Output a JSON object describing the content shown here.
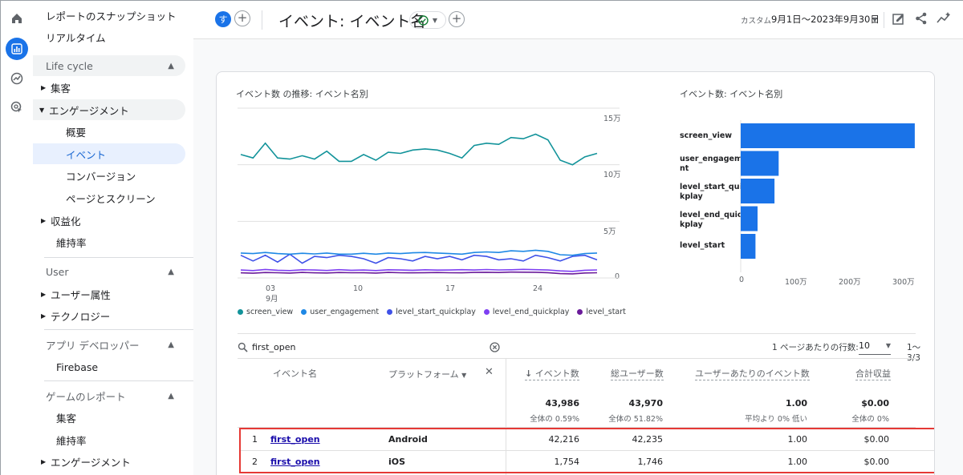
{
  "sidebar": {
    "items": [
      {
        "label": "レポートのスナップショット"
      },
      {
        "label": "リアルタイム"
      }
    ],
    "lifecycle": {
      "header": "Life cycle",
      "acquisition": "集客",
      "engagement": "エンゲージメント",
      "overview": "概要",
      "events": "イベント",
      "conversions": "コンバージョン",
      "pages": "ページとスクリーン",
      "monetization": "収益化",
      "retention": "維持率"
    },
    "user": {
      "header": "User",
      "attributes": "ユーザー属性",
      "technology": "テクノロジー"
    },
    "dev": {
      "header": "アプリ デベロッパー",
      "firebase": "Firebase"
    },
    "games": {
      "header": "ゲームのレポート",
      "acquisition": "集客",
      "retention": "維持率",
      "engagement": "エンゲージメント"
    }
  },
  "header": {
    "avatar_letter": "す",
    "title": "イベント: イベント名",
    "date_prefix": "カスタム",
    "date_range": "9月1日～2023年9月30日"
  },
  "line_chart": {
    "title": "イベント数 の推移: イベント名別",
    "y_ticks": [
      "15万",
      "10万",
      "5万",
      "0"
    ],
    "x_ticks": [
      "03",
      "10",
      "17",
      "24"
    ],
    "x_month": "9月",
    "legend": [
      {
        "name": "screen_view",
        "color": "#12939a"
      },
      {
        "name": "user_engagement",
        "color": "#1e88e5"
      },
      {
        "name": "level_start_quickplay",
        "color": "#3f51e8"
      },
      {
        "name": "level_end_quickplay",
        "color": "#7e3ff2"
      },
      {
        "name": "level_start",
        "color": "#6a1b9a"
      }
    ]
  },
  "chart_data": [
    {
      "type": "line",
      "title": "イベント数 の推移: イベント名別",
      "x": [
        1,
        2,
        3,
        4,
        5,
        6,
        7,
        8,
        9,
        10,
        11,
        12,
        13,
        14,
        15,
        16,
        17,
        18,
        19,
        20,
        21,
        22,
        23,
        24,
        25,
        26,
        27,
        28,
        29,
        30
      ],
      "ylim": [
        0,
        150000
      ],
      "series": [
        {
          "name": "screen_view",
          "values": [
            109000,
            106000,
            119000,
            106000,
            105000,
            108000,
            105000,
            112000,
            103000,
            103000,
            109000,
            104000,
            111000,
            110000,
            113000,
            114000,
            113000,
            110000,
            106000,
            117000,
            119000,
            118000,
            124000,
            123000,
            127000,
            122000,
            104000,
            100000,
            107000,
            110000
          ]
        },
        {
          "name": "user_engagement",
          "values": [
            22000,
            21500,
            22500,
            21500,
            21000,
            21800,
            21200,
            22000,
            21000,
            21000,
            21800,
            21000,
            22000,
            21500,
            22200,
            22500,
            22000,
            21500,
            21000,
            22500,
            23000,
            22500,
            24000,
            23500,
            24500,
            23500,
            20500,
            20000,
            21500,
            22000
          ]
        },
        {
          "name": "level_start_quickplay",
          "values": [
            20000,
            15000,
            20000,
            14000,
            21000,
            13000,
            19000,
            18000,
            20000,
            19000,
            17000,
            13000,
            18000,
            17000,
            15000,
            19000,
            17000,
            19000,
            16000,
            20000,
            19000,
            16000,
            17000,
            15000,
            20000,
            18000,
            15000,
            19000,
            20000,
            16000
          ]
        },
        {
          "name": "level_end_quickplay",
          "values": [
            7000,
            6500,
            7500,
            6800,
            6500,
            7200,
            7000,
            6600,
            7300,
            6800,
            7000,
            6500,
            7200,
            7000,
            6800,
            7200,
            6900,
            7000,
            7300,
            7000,
            7400,
            7100,
            7200,
            7600,
            7300,
            7000,
            6200,
            5800,
            6800,
            7100
          ]
        },
        {
          "name": "level_start",
          "values": [
            4500,
            4200,
            4800,
            4600,
            4300,
            4900,
            4500,
            4400,
            4800,
            4600,
            4700,
            4300,
            4900,
            4600,
            4500,
            4700,
            4800,
            4600,
            4500,
            4900,
            5000,
            4800,
            5200,
            5100,
            5000,
            4700,
            3800,
            3600,
            4400,
            4600
          ]
        }
      ]
    },
    {
      "type": "bar",
      "title": "イベント数: イベント名別",
      "categories": [
        "screen_view",
        "user_engagement",
        "level_start_quickplay",
        "level_end_quickplay",
        "level_start"
      ],
      "values": [
        3300000,
        720000,
        640000,
        320000,
        280000
      ],
      "x_ticks": [
        "0",
        "100万",
        "200万",
        "300万"
      ],
      "xlim": [
        0,
        3500000
      ]
    }
  ],
  "bar_chart": {
    "title": "イベント数: イベント名別",
    "labels": [
      [
        "screen_view"
      ],
      [
        "user_engageme",
        "nt"
      ],
      [
        "level_start_quic",
        "kplay"
      ],
      [
        "level_end_quic",
        "kplay"
      ],
      [
        "level_start"
      ]
    ]
  },
  "table": {
    "search_value": "first_open",
    "rows_per_page_label": "1 ページあたりの行数:",
    "rows_per_page": "10",
    "pagination": "1～3/3",
    "columns": {
      "event": "イベント名",
      "platform": "プラットフォーム",
      "count": "イベント数",
      "users": "総ユーザー数",
      "per_user": "ユーザーあたりのイベント数",
      "revenue": "合計収益"
    },
    "totals": {
      "count": "43,986",
      "count_sub": "全体の 0.59%",
      "users": "43,970",
      "users_sub": "全体の 51.82%",
      "per_user": "1.00",
      "per_user_sub": "平均より 0% 低い",
      "revenue": "$0.00",
      "revenue_sub": "全体の 0%"
    },
    "rows": [
      {
        "idx": "1",
        "event": "first_open",
        "platform": "Android",
        "count": "42,216",
        "users": "42,235",
        "per_user": "1.00",
        "revenue": "$0.00"
      },
      {
        "idx": "2",
        "event": "first_open",
        "platform": "iOS",
        "count": "1,754",
        "users": "1,746",
        "per_user": "1.00",
        "revenue": "$0.00"
      }
    ]
  }
}
